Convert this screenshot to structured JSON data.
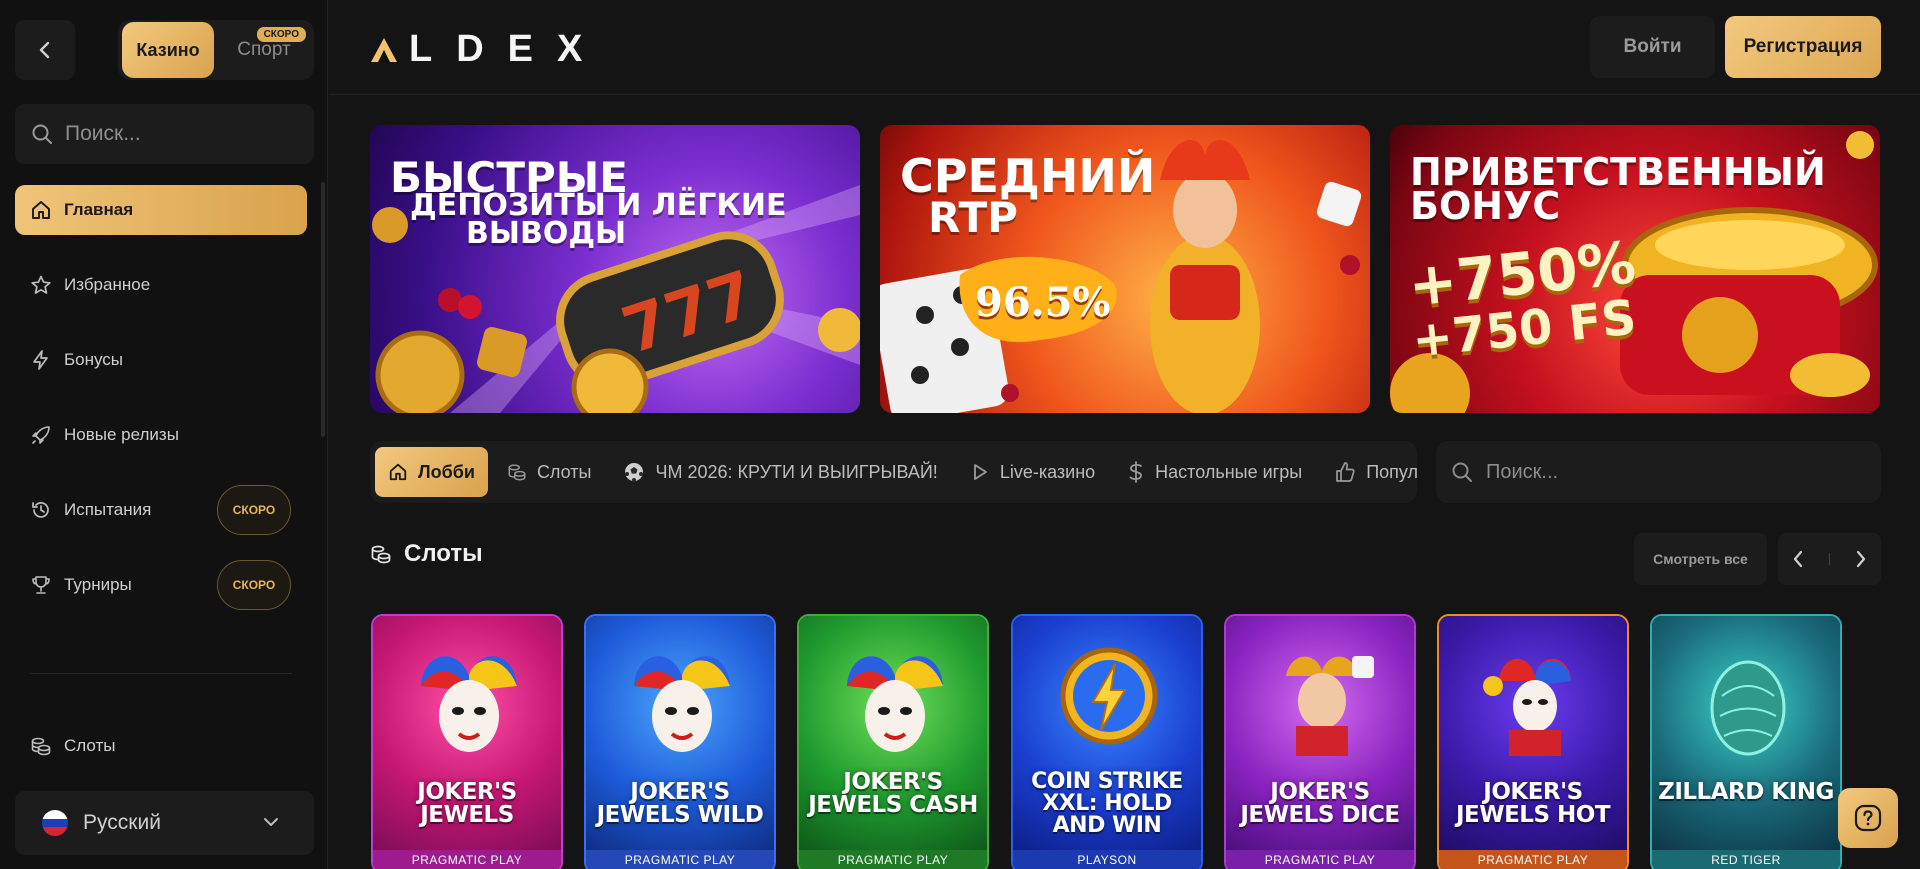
{
  "sidebar": {
    "mode_switch": {
      "casino": "Казино",
      "sport": "Спорт",
      "sport_badge": "СКОРО"
    },
    "search_placeholder": "Поиск...",
    "nav": [
      {
        "label": "Главная",
        "icon": "home-icon",
        "active": true
      },
      {
        "label": "Избранное",
        "icon": "star-icon"
      },
      {
        "label": "Бонусы",
        "icon": "lightning-icon"
      },
      {
        "label": "Новые релизы",
        "icon": "rocket-icon"
      },
      {
        "label": "Испытания",
        "icon": "history-icon",
        "badge": "СКОРО"
      },
      {
        "label": "Турниры",
        "icon": "trophy-icon",
        "badge": "СКОРО"
      },
      {
        "label": "Слоты",
        "icon": "coins-icon"
      }
    ],
    "language": "Русский"
  },
  "header": {
    "logo": "LDEX",
    "login": "Войти",
    "register": "Регистрация"
  },
  "banners": [
    {
      "line1": "БЫСТРЫЕ",
      "line2": "ДЕПОЗИТЫ И ЛЁГКИЕ",
      "line3": "ВЫВОДЫ"
    },
    {
      "line1": "СРЕДНИЙ",
      "line2": "RTP",
      "value": "96.5%"
    },
    {
      "line1": "ПРИВЕТСТВЕННЫЙ",
      "line2": "БОНУС",
      "line3": "+750%",
      "line4": "+750 FS"
    }
  ],
  "tabs": [
    {
      "label": "Лобби",
      "icon": "home-icon",
      "active": true
    },
    {
      "label": "Слоты",
      "icon": "coins-icon"
    },
    {
      "label": "ЧМ 2026: КРУТИ И ВЫИГРЫВАЙ!",
      "icon": "soccer-ball-icon"
    },
    {
      "label": "Live-казино",
      "icon": "play-icon"
    },
    {
      "label": "Настольные игры",
      "icon": "dollar-icon"
    },
    {
      "label": "Популярные",
      "icon": "thumbs-up-icon"
    }
  ],
  "main_search_placeholder": "Поиск...",
  "section": {
    "title": "Слоты",
    "see_all": "Смотреть все"
  },
  "games": [
    {
      "title": "JOKER'S JEWELS",
      "provider": "PRAGMATIC PLAY"
    },
    {
      "title": "JOKER'S JEWELS WILD",
      "provider": "PRAGMATIC PLAY"
    },
    {
      "title": "JOKER'S JEWELS CASH",
      "provider": "PRAGMATIC PLAY"
    },
    {
      "title": "COIN STRIKE XXL: HOLD AND WIN",
      "provider": "PLAYSON"
    },
    {
      "title": "JOKER'S JEWELS DICE",
      "provider": "PRAGMATIC PLAY"
    },
    {
      "title": "JOKER'S JEWELS HOT",
      "provider": "PRAGMATIC PLAY"
    },
    {
      "title": "ZILLARD KING",
      "provider": "RED TIGER"
    }
  ],
  "colors": {
    "accent": "#e7b45a",
    "background": "#141414",
    "panel": "#1c1c1c"
  }
}
